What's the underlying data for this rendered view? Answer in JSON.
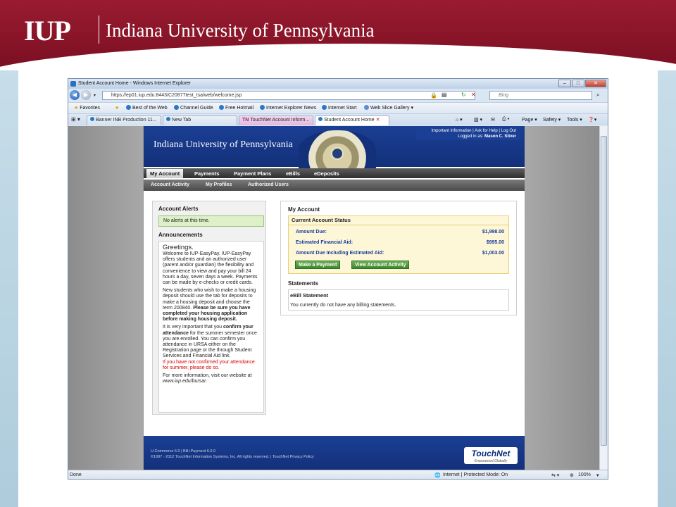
{
  "slide": {
    "logo": "IUP",
    "university": "Indiana University of Pennsylvania"
  },
  "browser": {
    "window_title": "Student Account Home - Windows Internet Explorer",
    "url": "https://ep01.iup.edu:8443/C20877test_tsa/web/welcome.jsp",
    "search_placeholder": "Bing",
    "favorites_label": "Favorites",
    "favorites": [
      "Best of the Web",
      "Channel Guide",
      "Free Hotmail",
      "Internet Explorer News",
      "Internet Start",
      "Web Slice Gallery ▾"
    ],
    "tabs": [
      "Banner INB Production 11...",
      "New Tab",
      "TouchNet Account Inform...",
      "Student Account Home"
    ],
    "commands": [
      "Page ▾",
      "Safety ▾",
      "Tools ▾"
    ],
    "status_left": "Done",
    "status_zone": "Internet | Protected Mode: On",
    "zoom": "100%"
  },
  "site": {
    "name": "Indiana University of Pennsylvania",
    "util_links": "Important Information | Ask for Help | Log Out",
    "logged_in_label": "Logged in as:",
    "logged_in_user": "Mason C. Stiver",
    "nav_primary": [
      "My Account",
      "Payments",
      "Payment Plans",
      "eBills",
      "eDeposits"
    ],
    "nav_secondary": [
      "Account Activity",
      "My Profiles",
      "Authorized Users"
    ],
    "alerts_title": "Account Alerts",
    "alert_text": "No alerts at this time.",
    "announcements_title": "Announcements",
    "announcement": {
      "greeting": "Greetings.",
      "p1": "Welcome to IUP-EasyPay. IUP-EasyPay offers students and an authorized user (parent and/or guardian) the flexibility and convenience to view and pay your bill 24 hours a day, seven days a week. Payments can be made by e-checks or credit cards.",
      "p2a": "New students who wish to make a housing deposit should use the tab for deposits to make a housing deposit and choose the term 200840.",
      "p2b": "Please be sure you have completed your housing application before making housing deposit.",
      "p3a": "It is very important that you",
      "p3b": "confirm your attendance",
      "p3c": "for the summer semester once you are enrolled. You can confirm you attendance in URSA either on the Registration page or the through Student Services and Financial Aid link.",
      "p3d": "If you have not confirmed your attendance for summer, please do so.",
      "p4a": "For more information, visit our website at",
      "p4b": "www.iup.edu/bursar."
    },
    "my_account_title": "My Account",
    "status_title": "Current Account Status",
    "amount_due_label": "Amount Due:",
    "amount_due": "$1,998.00",
    "aid_label": "Estimated Financial Aid:",
    "aid": "$995.00",
    "due_incl_label": "Amount Due Including Estimated Aid:",
    "due_incl": "$1,003.00",
    "make_payment": "Make a Payment",
    "view_activity": "View Account Activity",
    "statements_title": "Statements",
    "ebill_title": "eBill Statement",
    "ebill_text": "You currently do not have any billing statements.",
    "footer_line1": "U.Commerce 6.0 | Bill+Payment 6.0.0",
    "footer_line2": "©1997 - 2012 TouchNet Information Systems, Inc. All rights reserved. | TouchNet Privacy Policy",
    "brand": "TouchNet",
    "brand_sub": "Empowered Globally"
  }
}
